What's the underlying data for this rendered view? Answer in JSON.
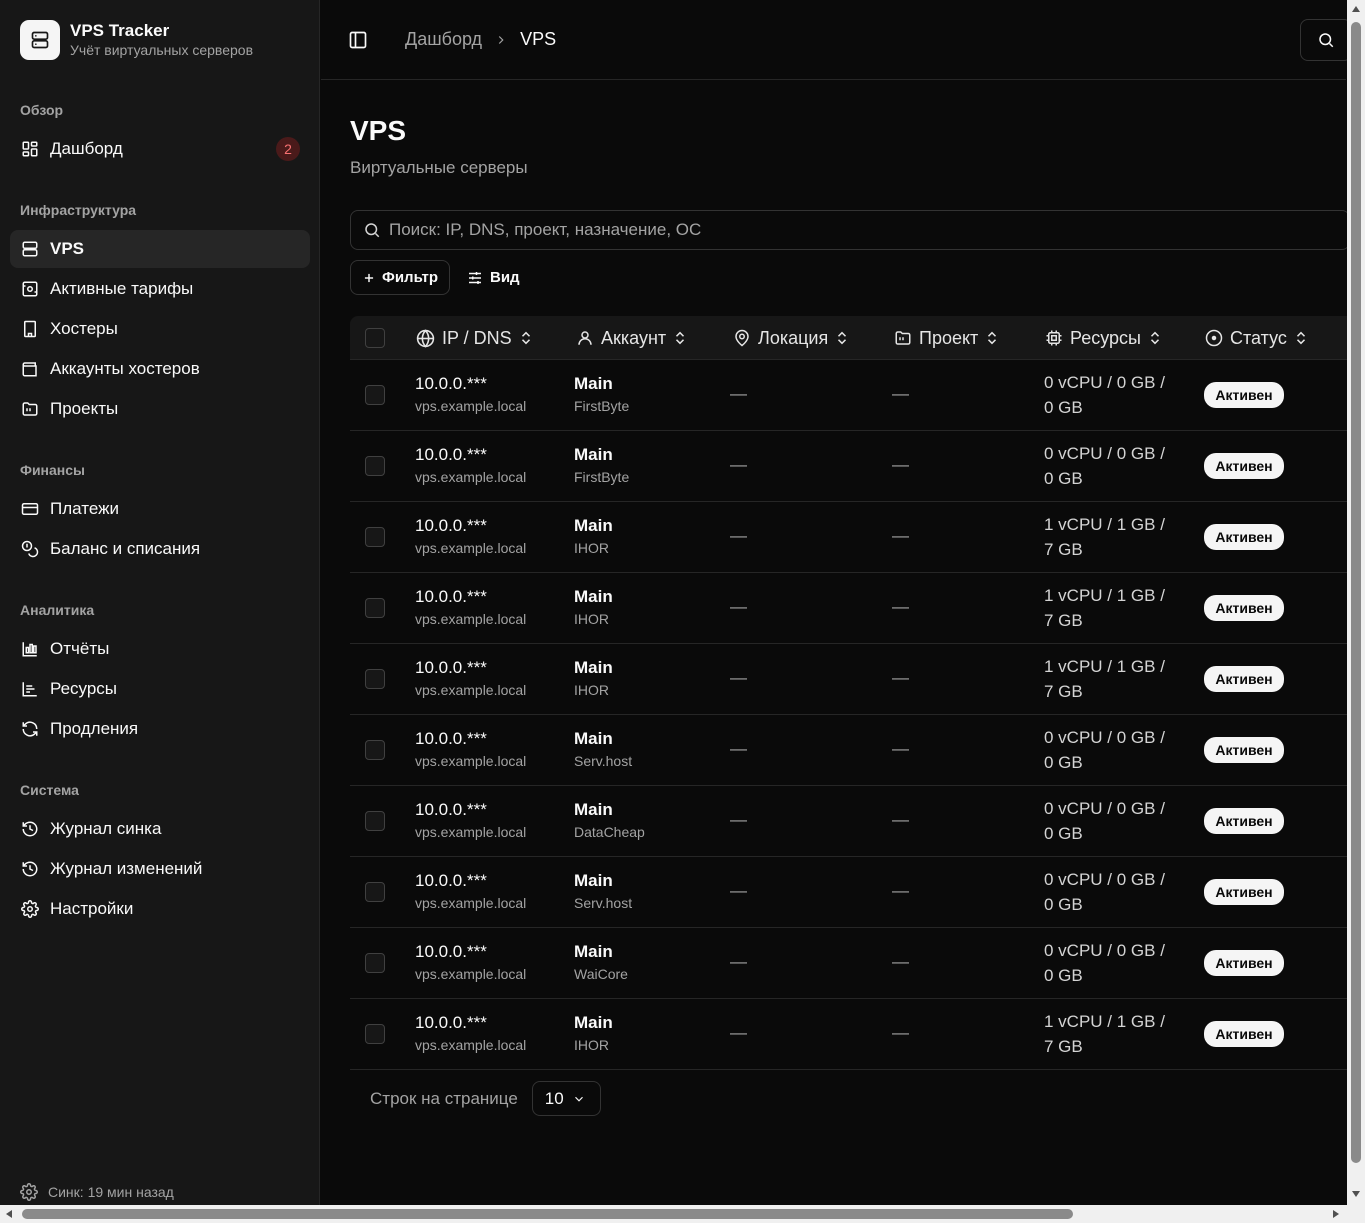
{
  "brand": {
    "title": "VPS Tracker",
    "subtitle": "Учёт виртуальных серверов",
    "icon": "server-stack-icon"
  },
  "sidebar": {
    "sections": [
      {
        "label": "Обзор",
        "items": [
          {
            "label": "Дашборд",
            "icon": "dashboard-grid-icon",
            "badge": "2"
          }
        ]
      },
      {
        "label": "Инфраструктура",
        "items": [
          {
            "label": "VPS",
            "icon": "server-icon",
            "active": true
          },
          {
            "label": "Активные тарифы",
            "icon": "tariff-icon"
          },
          {
            "label": "Хостеры",
            "icon": "building-icon"
          },
          {
            "label": "Аккаунты хостеров",
            "icon": "wallet-icon"
          },
          {
            "label": "Проекты",
            "icon": "folder-icon"
          }
        ]
      },
      {
        "label": "Финансы",
        "items": [
          {
            "label": "Платежи",
            "icon": "credit-card-icon"
          },
          {
            "label": "Баланс и списания",
            "icon": "coins-icon"
          }
        ]
      },
      {
        "label": "Аналитика",
        "items": [
          {
            "label": "Отчёты",
            "icon": "bar-chart-icon"
          },
          {
            "label": "Ресурсы",
            "icon": "resources-chart-icon"
          },
          {
            "label": "Продления",
            "icon": "refresh-icon"
          }
        ]
      },
      {
        "label": "Система",
        "items": [
          {
            "label": "Журнал синка",
            "icon": "history-icon"
          },
          {
            "label": "Журнал изменений",
            "icon": "history-icon"
          },
          {
            "label": "Настройки",
            "icon": "gear-icon"
          }
        ]
      }
    ],
    "sync_status": "Синк: 19 мин назад"
  },
  "header": {
    "breadcrumb_home": "Дашборд",
    "breadcrumb_current": "VPS"
  },
  "page": {
    "title": "VPS",
    "subtitle": "Виртуальные серверы",
    "search_placeholder": "Поиск: IP, DNS, проект, назначение, ОС",
    "filter_label": "Фильтр",
    "view_label": "Вид"
  },
  "table": {
    "columns": [
      {
        "label": "IP / DNS",
        "icon": "globe-icon"
      },
      {
        "label": "Аккаунт",
        "icon": "user-icon"
      },
      {
        "label": "Локация",
        "icon": "map-pin-icon"
      },
      {
        "label": "Проект",
        "icon": "folder-icon"
      },
      {
        "label": "Ресурсы",
        "icon": "cpu-icon"
      },
      {
        "label": "Статус",
        "icon": "status-circle-icon"
      }
    ],
    "rows": [
      {
        "ip": "10.0.0.***",
        "dns": "vps.example.local",
        "account": "Main",
        "hoster": "FirstByte",
        "location": "—",
        "project": "—",
        "res1": "0 vCPU / 0 GB /",
        "res2": "0 GB",
        "status": "Активен"
      },
      {
        "ip": "10.0.0.***",
        "dns": "vps.example.local",
        "account": "Main",
        "hoster": "FirstByte",
        "location": "—",
        "project": "—",
        "res1": "0 vCPU / 0 GB /",
        "res2": "0 GB",
        "status": "Активен"
      },
      {
        "ip": "10.0.0.***",
        "dns": "vps.example.local",
        "account": "Main",
        "hoster": "IHOR",
        "location": "—",
        "project": "—",
        "res1": "1 vCPU / 1 GB /",
        "res2": "7 GB",
        "status": "Активен"
      },
      {
        "ip": "10.0.0.***",
        "dns": "vps.example.local",
        "account": "Main",
        "hoster": "IHOR",
        "location": "—",
        "project": "—",
        "res1": "1 vCPU / 1 GB /",
        "res2": "7 GB",
        "status": "Активен"
      },
      {
        "ip": "10.0.0.***",
        "dns": "vps.example.local",
        "account": "Main",
        "hoster": "IHOR",
        "location": "—",
        "project": "—",
        "res1": "1 vCPU / 1 GB /",
        "res2": "7 GB",
        "status": "Активен"
      },
      {
        "ip": "10.0.0.***",
        "dns": "vps.example.local",
        "account": "Main",
        "hoster": "Serv.host",
        "location": "—",
        "project": "—",
        "res1": "0 vCPU / 0 GB /",
        "res2": "0 GB",
        "status": "Активен"
      },
      {
        "ip": "10.0.0.***",
        "dns": "vps.example.local",
        "account": "Main",
        "hoster": "DataCheap",
        "location": "—",
        "project": "—",
        "res1": "0 vCPU / 0 GB /",
        "res2": "0 GB",
        "status": "Активен"
      },
      {
        "ip": "10.0.0.***",
        "dns": "vps.example.local",
        "account": "Main",
        "hoster": "Serv.host",
        "location": "—",
        "project": "—",
        "res1": "0 vCPU / 0 GB /",
        "res2": "0 GB",
        "status": "Активен"
      },
      {
        "ip": "10.0.0.***",
        "dns": "vps.example.local",
        "account": "Main",
        "hoster": "WaiCore",
        "location": "—",
        "project": "—",
        "res1": "0 vCPU / 0 GB /",
        "res2": "0 GB",
        "status": "Активен"
      },
      {
        "ip": "10.0.0.***",
        "dns": "vps.example.local",
        "account": "Main",
        "hoster": "IHOR",
        "location": "—",
        "project": "—",
        "res1": "1 vCPU / 1 GB /",
        "res2": "7 GB",
        "status": "Активен"
      }
    ]
  },
  "pagination": {
    "rows_label": "Строк на странице",
    "rows_value": "10"
  },
  "colors": {
    "background": "#0a0a0a",
    "sidebar": "#171717",
    "badge_bg": "#f5f5f5",
    "count_badge": "#f87171"
  }
}
